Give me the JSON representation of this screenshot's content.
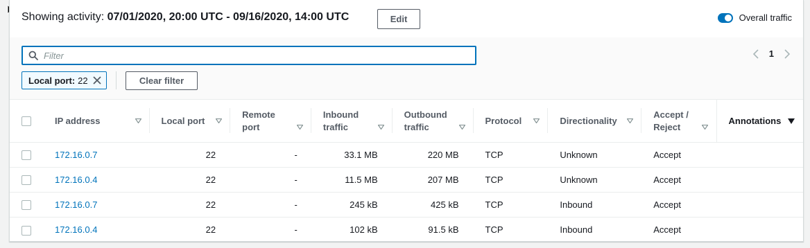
{
  "header": {
    "activity_prefix": "Showing activity: ",
    "activity_range": "07/01/2020, 20:00 UTC - 09/16/2020, 14:00 UTC",
    "edit_label": "Edit",
    "toggle_label": "Overall traffic",
    "toggle_on": true
  },
  "filter": {
    "placeholder": "Filter",
    "token_key": "Local port:",
    "token_value": "22",
    "clear_label": "Clear filter"
  },
  "pagination": {
    "current_page": "1"
  },
  "colors": {
    "accent": "#0073bb",
    "border": "#eaeded",
    "header_text": "#545b64"
  },
  "table": {
    "columns": [
      "IP address",
      "Local port",
      "Remote\nport",
      "Inbound\ntraffic",
      "Outbound\ntraffic",
      "Protocol",
      "Directionality",
      "Accept /\nReject",
      "Annotations"
    ],
    "rows": [
      {
        "ip": "172.16.0.7",
        "local_port": "22",
        "remote_port": "-",
        "inbound": "33.1 MB",
        "outbound": "220 MB",
        "protocol": "TCP",
        "direction": "Unknown",
        "accept": "Accept"
      },
      {
        "ip": "172.16.0.4",
        "local_port": "22",
        "remote_port": "-",
        "inbound": "11.5 MB",
        "outbound": "207 MB",
        "protocol": "TCP",
        "direction": "Unknown",
        "accept": "Accept"
      },
      {
        "ip": "172.16.0.7",
        "local_port": "22",
        "remote_port": "-",
        "inbound": "245 kB",
        "outbound": "425 kB",
        "protocol": "TCP",
        "direction": "Inbound",
        "accept": "Accept"
      },
      {
        "ip": "172.16.0.4",
        "local_port": "22",
        "remote_port": "-",
        "inbound": "102 kB",
        "outbound": "91.5 kB",
        "protocol": "TCP",
        "direction": "Inbound",
        "accept": "Accept"
      }
    ]
  }
}
